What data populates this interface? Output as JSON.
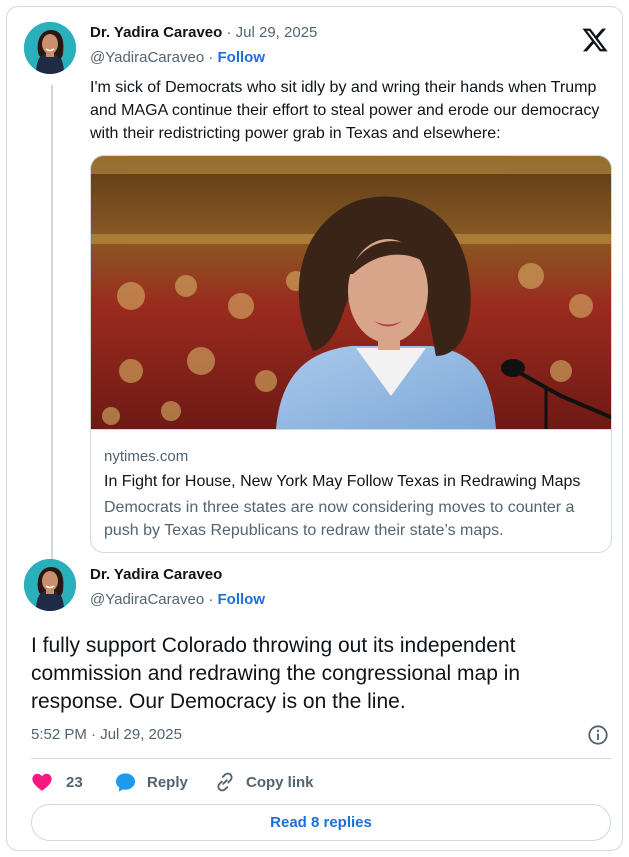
{
  "tweet1": {
    "author_name": "Dr. Yadira Caraveo",
    "date": "Jul 29, 2025",
    "handle": "@YadiraCaraveo",
    "follow_label": "Follow",
    "text": "I'm sick of Democrats who sit idly by and wring their hands when Trump and MAGA continue their effort to steal power and erode our democracy with their redistricting power grab in Texas and elsewhere:",
    "link_card": {
      "domain": "nytimes.com",
      "title": "In Fight for House, New York May Follow Texas in Redrawing Maps",
      "description": "Democrats in three states are now considering moves to counter a push by Texas Republicans to redraw their state’s maps."
    }
  },
  "tweet2": {
    "author_name": "Dr. Yadira Caraveo",
    "handle": "@YadiraCaraveo",
    "follow_label": "Follow",
    "text": "I fully support Colorado throwing out its independent commission and redrawing the congressional map in response. Our Democracy is on the line.",
    "timestamp": "5:52 PM · Jul 29, 2025"
  },
  "separator": "·",
  "actions": {
    "likes_count": "23",
    "reply_label": "Reply",
    "copy_link_label": "Copy link"
  },
  "read_replies_label": "Read 8 replies",
  "icons": {
    "brand": "x-logo-icon",
    "like": "heart-icon",
    "reply": "speech-bubble-icon",
    "copy_link": "link-icon",
    "info": "info-icon"
  },
  "colors": {
    "link_blue": "#1d6fd9",
    "like_pink": "#f91880",
    "reply_blue": "#1d9bf0",
    "muted_text": "#536471",
    "border": "#cfd9de"
  }
}
